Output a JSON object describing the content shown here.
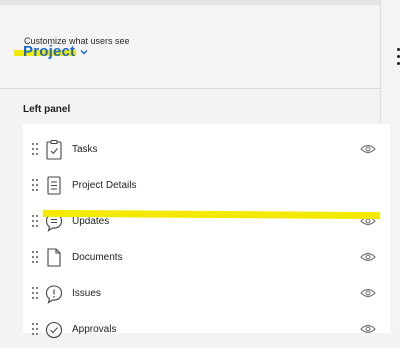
{
  "header": {
    "subtitle": "Customize what users see",
    "title": "Project",
    "title_color": "#1769d6",
    "highlight_color": "#f4ea00"
  },
  "left_panel": {
    "heading": "Left panel",
    "items": [
      {
        "label": "Tasks",
        "icon": "tasks-clipboard-icon",
        "visible_toggle": true
      },
      {
        "label": "Project Details",
        "icon": "document-lines-icon",
        "visible_toggle": false
      },
      {
        "label": "Updates",
        "icon": "speech-bubble-icon",
        "visible_toggle": true
      },
      {
        "label": "Documents",
        "icon": "blank-document-icon",
        "visible_toggle": true
      },
      {
        "label": "Issues",
        "icon": "exclamation-bubble-icon",
        "visible_toggle": true
      },
      {
        "label": "Approvals",
        "icon": "check-circle-icon",
        "visible_toggle": true
      }
    ]
  }
}
